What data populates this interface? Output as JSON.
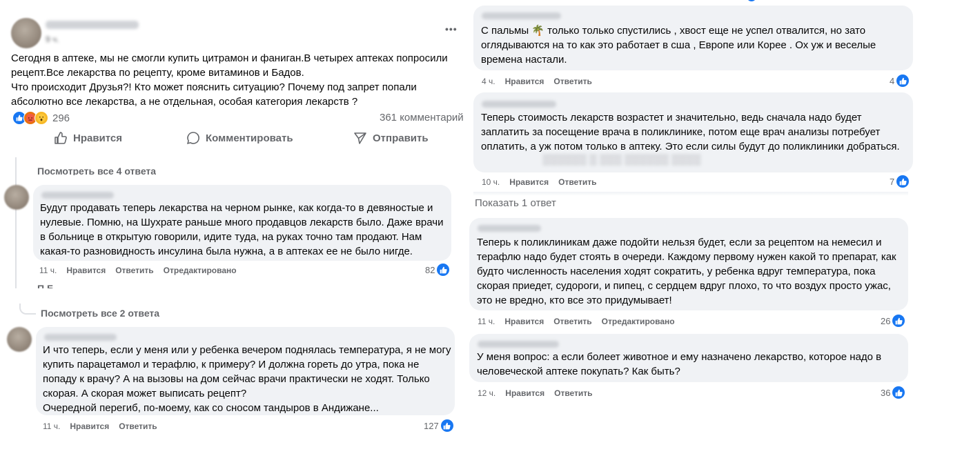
{
  "post": {
    "time": "9 ч.",
    "menu": "•••",
    "text": "Сегодня в аптеке, мы не смогли купить цитрамон и фаниган.В  четырех аптеках попросили рецепт.Все лекарства по рецепту, кроме витаминов и Бадов.\nЧто происходит Друзья?! Кто может пояснить  ситуацию? Почему под запрет попали абсолютно все лекарства, а не отдельная,  особая категория лекарств ?",
    "reaction_count": "296",
    "comment_count": "361 комментарий",
    "actions": {
      "like": "Нравится",
      "comment": "Комментировать",
      "share": "Отправить"
    }
  },
  "left": {
    "view_replies_4": "Посмотреть все 4 ответа",
    "view_replies_2": "Посмотреть все 2 ответа",
    "comments": [
      {
        "text": "Будут продавать теперь лекарства на черном рынке, как когда-то в девяностые и нулевые. Помню, на Шухрате раньше много продавцов лекарств было. Даже врачи в больнице в открытую говорили, идите туда, на руках точно там продают. Нам какая-то разновидность инсулина была нужна, а в аптеках ее не было нигде.",
        "time": "11 ч.",
        "like": "Нравится",
        "reply": "Ответить",
        "edited": "Отредактировано",
        "likes": "82"
      },
      {
        "text": "И что теперь, если у меня или у ребенка вечером поднялась температура, я не могу купить парацетамол и терафлю, к примеру? И должна гореть до утра, пока не попаду к врачу? А на вызовы на дом сейчас врачи практически не ходят. Только скорая. А скорая может выписать рецепт?\nОчередной перегиб, по-моему, как со сносом тандыров в Андижане...",
        "time": "11 ч.",
        "like": "Нравится",
        "reply": "Ответить",
        "likes": "127"
      }
    ]
  },
  "right": {
    "show_reply": "Показать 1 ответ",
    "comments": [
      {
        "text": "С пальмы 🌴 только только спустились , хвост еще не успел отвалится, но зато оглядываются на то как это работает в сша , Европе или Корее . Ох уж и веселые времена настали.",
        "time": "4 ч.",
        "like": "Нравится",
        "reply": "Ответить",
        "likes": "4"
      },
      {
        "text": "Теперь стоимость лекарств возрастет и значительно, ведь сначала надо будет заплатить за посещение врача в поликлинике, потом еще врач анализы потребует оплатить, а уж потом только в аптеку. Это если силы будут до поликлиники добраться.",
        "time": "10 ч.",
        "like": "Нравится",
        "reply": "Ответить",
        "likes": "7"
      },
      {
        "text": "Теперь к поликлиникам даже подойти нельзя будет, если за рецептом на немесил и терафлю надо будет стоять в очереди. Каждому первому нужен какой то препарат, как будто численность населения ходят сократить, у ребенка вдруг температура, пока скорая приедет, судороги, и пипец, с сердцем вдруг плохо, то что воздух просто ужас, это не вредно, кто все это придумывает!",
        "time": "11 ч.",
        "like": "Нравится",
        "reply": "Ответить",
        "edited": "Отредактировано",
        "likes": "26"
      },
      {
        "text": "У меня вопрос: а если болеет животное и ему назначено лекарство, которое надо в человеческой аптеке покупать? Как быть?",
        "time": "12 ч.",
        "like": "Нравится",
        "reply": "Ответить",
        "likes": "36"
      }
    ]
  }
}
